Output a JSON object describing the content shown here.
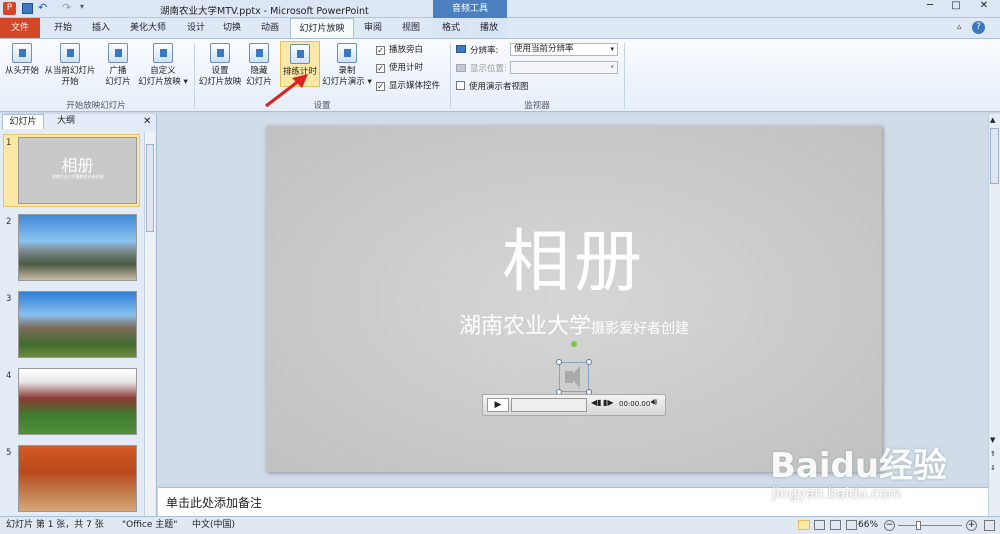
{
  "window": {
    "title": "湖南农业大学MTV.pptx - Microsoft PowerPoint",
    "context_tab": "音频工具"
  },
  "tabs": [
    "文件",
    "开始",
    "插入",
    "美化大师",
    "设计",
    "切换",
    "动画",
    "幻灯片放映",
    "审阅",
    "视图",
    "格式",
    "播放"
  ],
  "ribbon": {
    "group1": {
      "label": "开始放映幻灯片",
      "buttons": [
        "从头开始",
        "从当前幻灯片\n开始",
        "广播\n幻灯片",
        "自定义\n幻灯片放映 ▾"
      ]
    },
    "group2": {
      "label": "设置",
      "buttons": [
        "设置\n幻灯片放映",
        "隐藏\n幻灯片",
        "排练计时",
        "录制\n幻灯片演示 ▾"
      ],
      "checkboxes": [
        {
          "label": "播放旁白",
          "checked": true
        },
        {
          "label": "使用计时",
          "checked": true
        },
        {
          "label": "显示媒体控件",
          "checked": true
        }
      ]
    },
    "group3": {
      "label": "监视器",
      "resolution_label": "分辨率:",
      "resolution_value": "使用当前分辨率",
      "display_label": "显示位置:",
      "display_value": "",
      "presenter_view": "使用演示者视图",
      "presenter_checked": false
    }
  },
  "left_panel": {
    "tabs": [
      "幻灯片",
      "大纲"
    ],
    "thumb_title": "相册",
    "thumb_sub": "湖南农业大学摄影爱好者创建",
    "slide_numbers": [
      "1",
      "2",
      "3",
      "4",
      "5"
    ]
  },
  "slide": {
    "title": "相册",
    "subtitle_main": "湖南农业大学",
    "subtitle_small": "摄影爱好者创建",
    "media_time": "00:00.00"
  },
  "notes_placeholder": "单击此处添加备注",
  "status": {
    "slide_info": "幻灯片 第 1 张，共 7 张",
    "theme": "\"Office 主题\"",
    "language": "中文(中国)",
    "zoom": "66%"
  },
  "watermark": {
    "brand": "Baidu经验",
    "url": "jingyan.baidu.com"
  },
  "colors": {
    "file_tab": "#d24726",
    "context": "#4a7fc0",
    "accent": "#3b78c3",
    "arrow": "#e02020"
  }
}
